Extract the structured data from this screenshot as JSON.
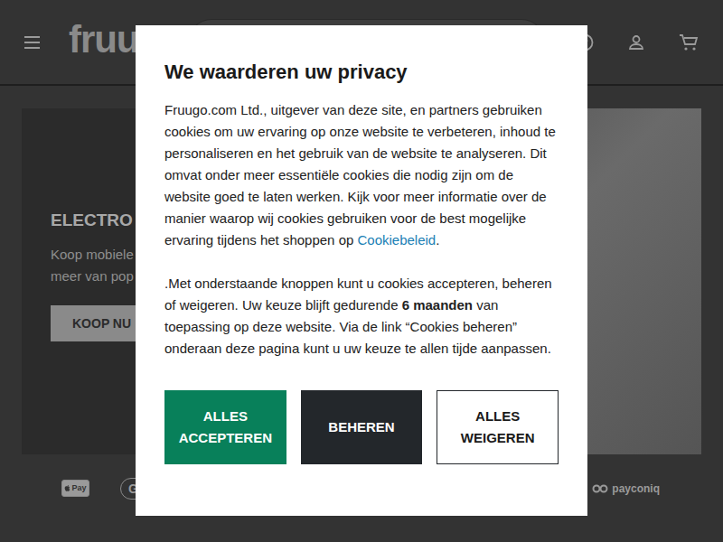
{
  "header": {
    "logo": "fruug"
  },
  "hero": {
    "title": "ELECTRO",
    "lines": [
      "Koop mobiele",
      "meer van pop"
    ],
    "button": "KOOP NU"
  },
  "payments": [
    "Pay",
    "G",
    "payconiq"
  ],
  "modal": {
    "title": "We waarderen uw privacy",
    "intro": "Fruugo.com Ltd., uitgever van deze site, en partners gebruiken cookies om uw ervaring op onze website te verbeteren, inhoud te personaliseren en het gebruik van de website te analyseren. Dit omvat onder meer essentiële cookies die nodig zijn om de website goed te laten werken. Kijk voor meer informatie over de manier waarop wij cookies gebruiken voor de best mogelijke ervaring tijdens het shoppen op ",
    "link": "Cookiebeleid",
    "intro_end": ".",
    "choice_before": ".Met onderstaande knoppen kunt u cookies accepteren, beheren of weigeren. Uw keuze blijft gedurende ",
    "choice_bold": "6 maanden",
    "choice_after": " van toepassing op deze website. Via de link “Cookies beheren” onderaan deze pagina kunt u uw keuze te allen tijde aanpassen.",
    "buttons": [
      {
        "label": "ALLES ACCEPTEREN",
        "kind": "primary"
      },
      {
        "label": "BEHEREN",
        "kind": "dark"
      },
      {
        "label": "ALLES WEIGEREN",
        "kind": "outline"
      }
    ]
  }
}
